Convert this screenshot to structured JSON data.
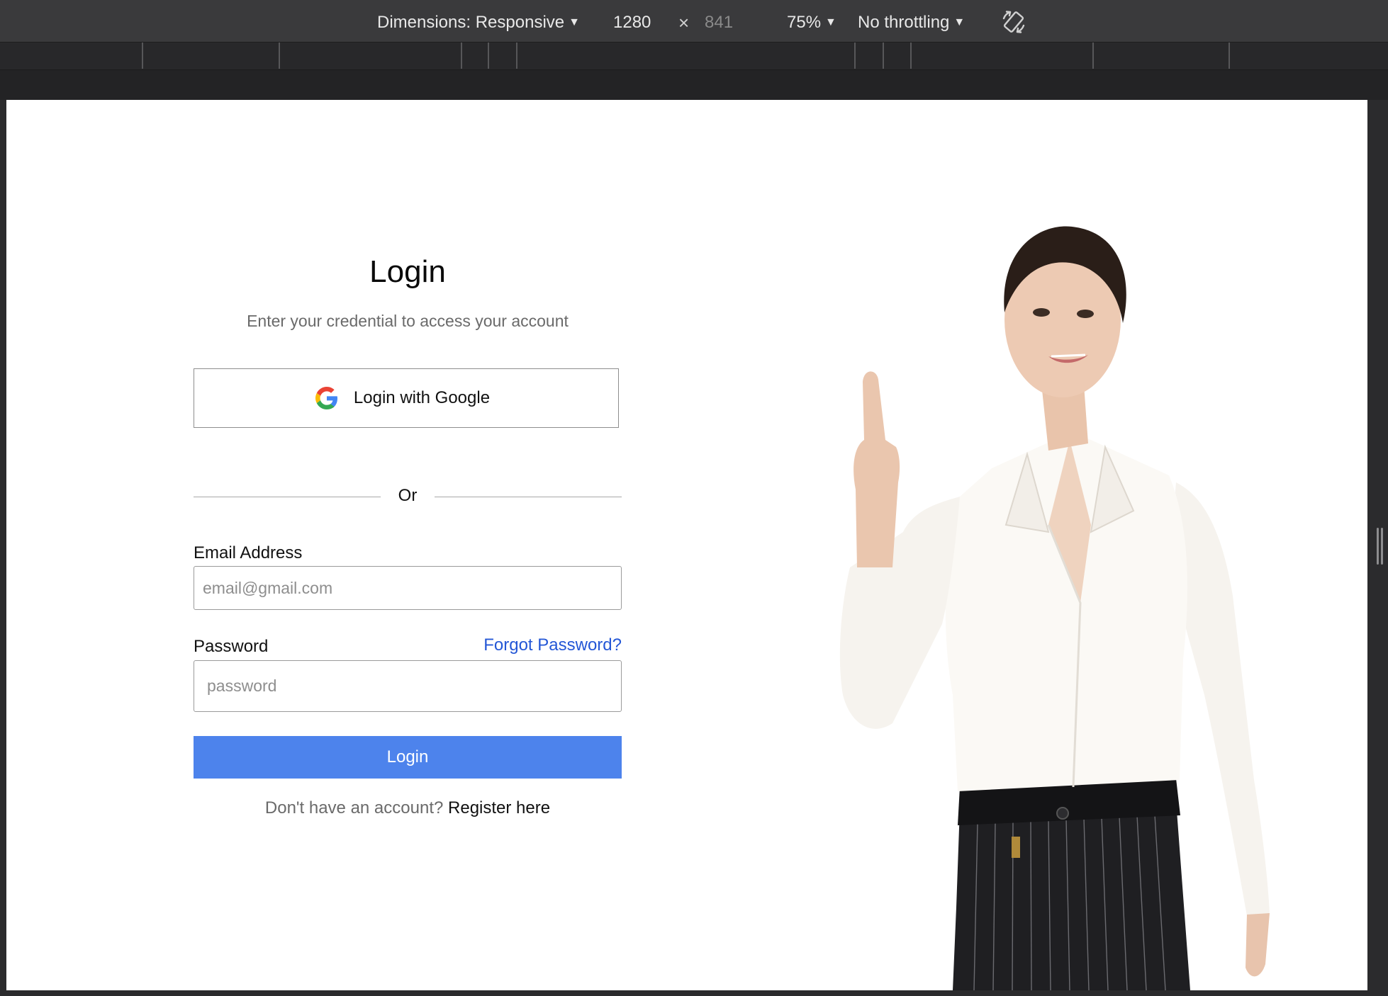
{
  "devtools": {
    "dimensions_label": "Dimensions: Responsive",
    "width": "1280",
    "height": "841",
    "times": "×",
    "zoom": "75%",
    "throttling": "No throttling",
    "rotate_icon": "rotate-icon",
    "caret_icon": "▼"
  },
  "login": {
    "title": "Login",
    "subtitle": "Enter your credential to access your account",
    "google_label": "Login with Google",
    "divider": "Or",
    "email_label": "Email Address",
    "email_placeholder": "email@gmail.com",
    "password_label": "Password",
    "forgot": "Forgot Password?",
    "password_placeholder": "password",
    "submit": "Login",
    "register_prompt": "Don't have an account?",
    "register_link": "Register here"
  },
  "colors": {
    "primary": "#4d83ec",
    "link": "#2457d6",
    "devtools_bg": "#3a3a3c"
  }
}
